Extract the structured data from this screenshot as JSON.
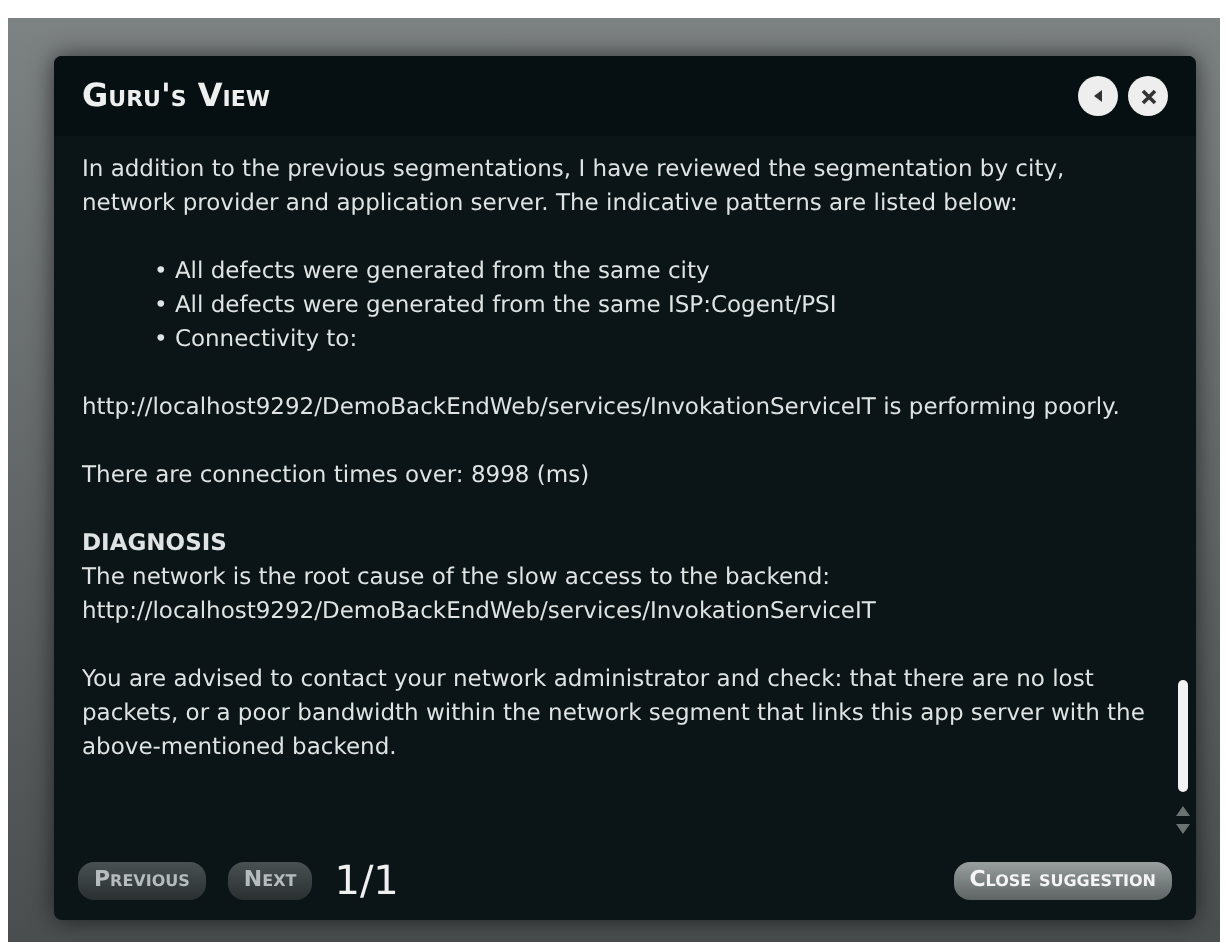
{
  "window": {
    "title": "Guru's View"
  },
  "body": {
    "intro": "In addition to the previous segmentations, I have reviewed the segmentation by city, network provider and application server. The indicative patterns are listed below:",
    "bullets": [
      "• All defects were generated from the same city",
      "• All defects were generated from the same ISP:Cogent/PSI",
      "• Connectivity to:"
    ],
    "paragraphs": [
      "http://localhost9292/DemoBackEndWeb/services/InvokationServiceIT is performing poorly.",
      "There are connection times over: 8998 (ms)"
    ],
    "diagnosis_heading": "DIAGNOSIS",
    "diagnosis_lines": [
      "The network is the root cause of the slow access to the backend:",
      "http://localhost9292/DemoBackEndWeb/services/InvokationServiceIT"
    ],
    "advice": "You are advised to contact your network administrator and check: that there are no lost packets, or a poor bandwidth within the network segment that links this app server with the above-mentioned backend."
  },
  "footer": {
    "previous": "Previous",
    "next": "Next",
    "page": "1/1",
    "close": "Close suggestion"
  }
}
